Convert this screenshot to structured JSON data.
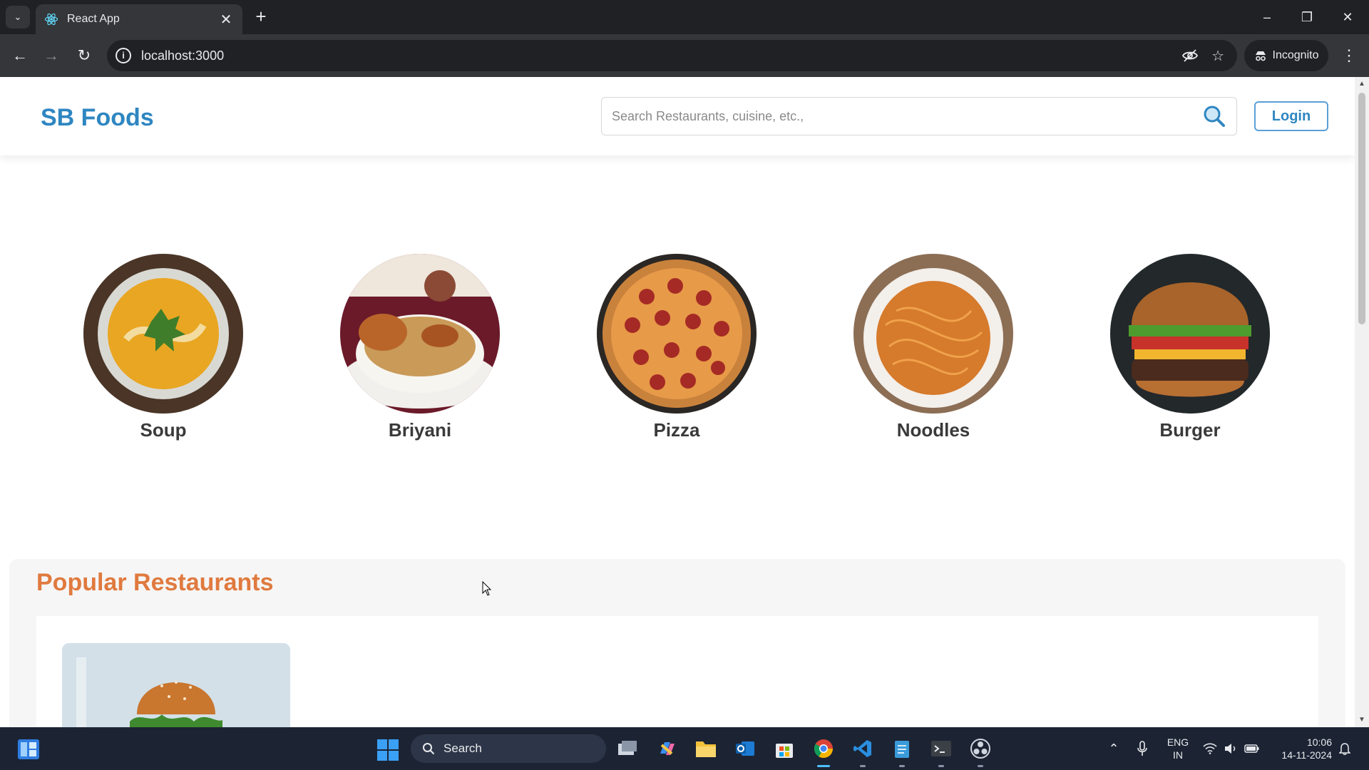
{
  "browser": {
    "tab_title": "React App",
    "url": "localhost:3000",
    "incognito_label": "Incognito"
  },
  "site": {
    "logo": "SB Foods",
    "search_placeholder": "Search Restaurants, cuisine, etc.,",
    "login_label": "Login",
    "brand_color": "#2e86c1",
    "accent_color": "#e07a3f"
  },
  "categories": [
    {
      "label": "Soup",
      "icon": "soup-bowl-image"
    },
    {
      "label": "Briyani",
      "icon": "briyani-plate-image"
    },
    {
      "label": "Pizza",
      "icon": "pepperoni-pizza-image"
    },
    {
      "label": "Noodles",
      "icon": "noodles-bowl-image"
    },
    {
      "label": "Burger",
      "icon": "burger-image"
    }
  ],
  "popular": {
    "title": "Popular Restaurants"
  },
  "taskbar": {
    "search_label": "Search",
    "lang_line1": "ENG",
    "lang_line2": "IN",
    "time": "10:06",
    "date": "14-11-2024"
  }
}
